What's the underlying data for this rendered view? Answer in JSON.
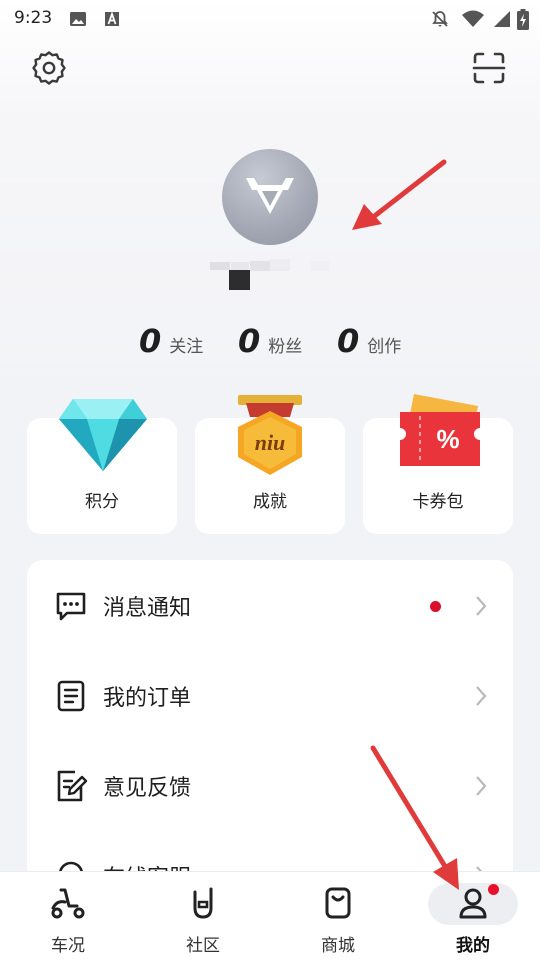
{
  "status_bar": {
    "time": "9:23",
    "left_icons": [
      "image-icon",
      "a-box-icon"
    ],
    "right_icons": [
      "notifications-off-icon",
      "wifi-icon",
      "signal-icon",
      "battery-charging-icon"
    ]
  },
  "header": {
    "settings_icon": "gear-icon",
    "scan_icon": "scan-icon"
  },
  "profile": {
    "avatar_icon": "bull-logo-icon"
  },
  "stats": [
    {
      "value": "0",
      "label": "关注"
    },
    {
      "value": "0",
      "label": "粉丝"
    },
    {
      "value": "0",
      "label": "创作"
    }
  ],
  "cards": [
    {
      "label": "积分",
      "icon": "diamond-icon"
    },
    {
      "label": "成就",
      "icon": "medal-icon",
      "badge_text": "niu"
    },
    {
      "label": "卡券包",
      "icon": "coupon-icon",
      "badge_text": "%"
    }
  ],
  "menu": [
    {
      "label": "消息通知",
      "icon": "message-icon",
      "has_dot": true
    },
    {
      "label": "我的订单",
      "icon": "order-icon",
      "has_dot": false
    },
    {
      "label": "意见反馈",
      "icon": "feedback-icon",
      "has_dot": false
    },
    {
      "label": "在线客服",
      "icon": "support-icon",
      "has_dot": false
    }
  ],
  "tabs": [
    {
      "label": "车况",
      "icon": "scooter-icon",
      "active": false
    },
    {
      "label": "社区",
      "icon": "community-icon",
      "active": false
    },
    {
      "label": "商城",
      "icon": "shop-bag-icon",
      "active": false
    },
    {
      "label": "我的",
      "icon": "person-icon",
      "active": true,
      "has_dot": true
    }
  ],
  "colors": {
    "accent_red": "#d8102a",
    "annotation_arrow": "#e03a3a",
    "background": "#f2f3f6"
  }
}
